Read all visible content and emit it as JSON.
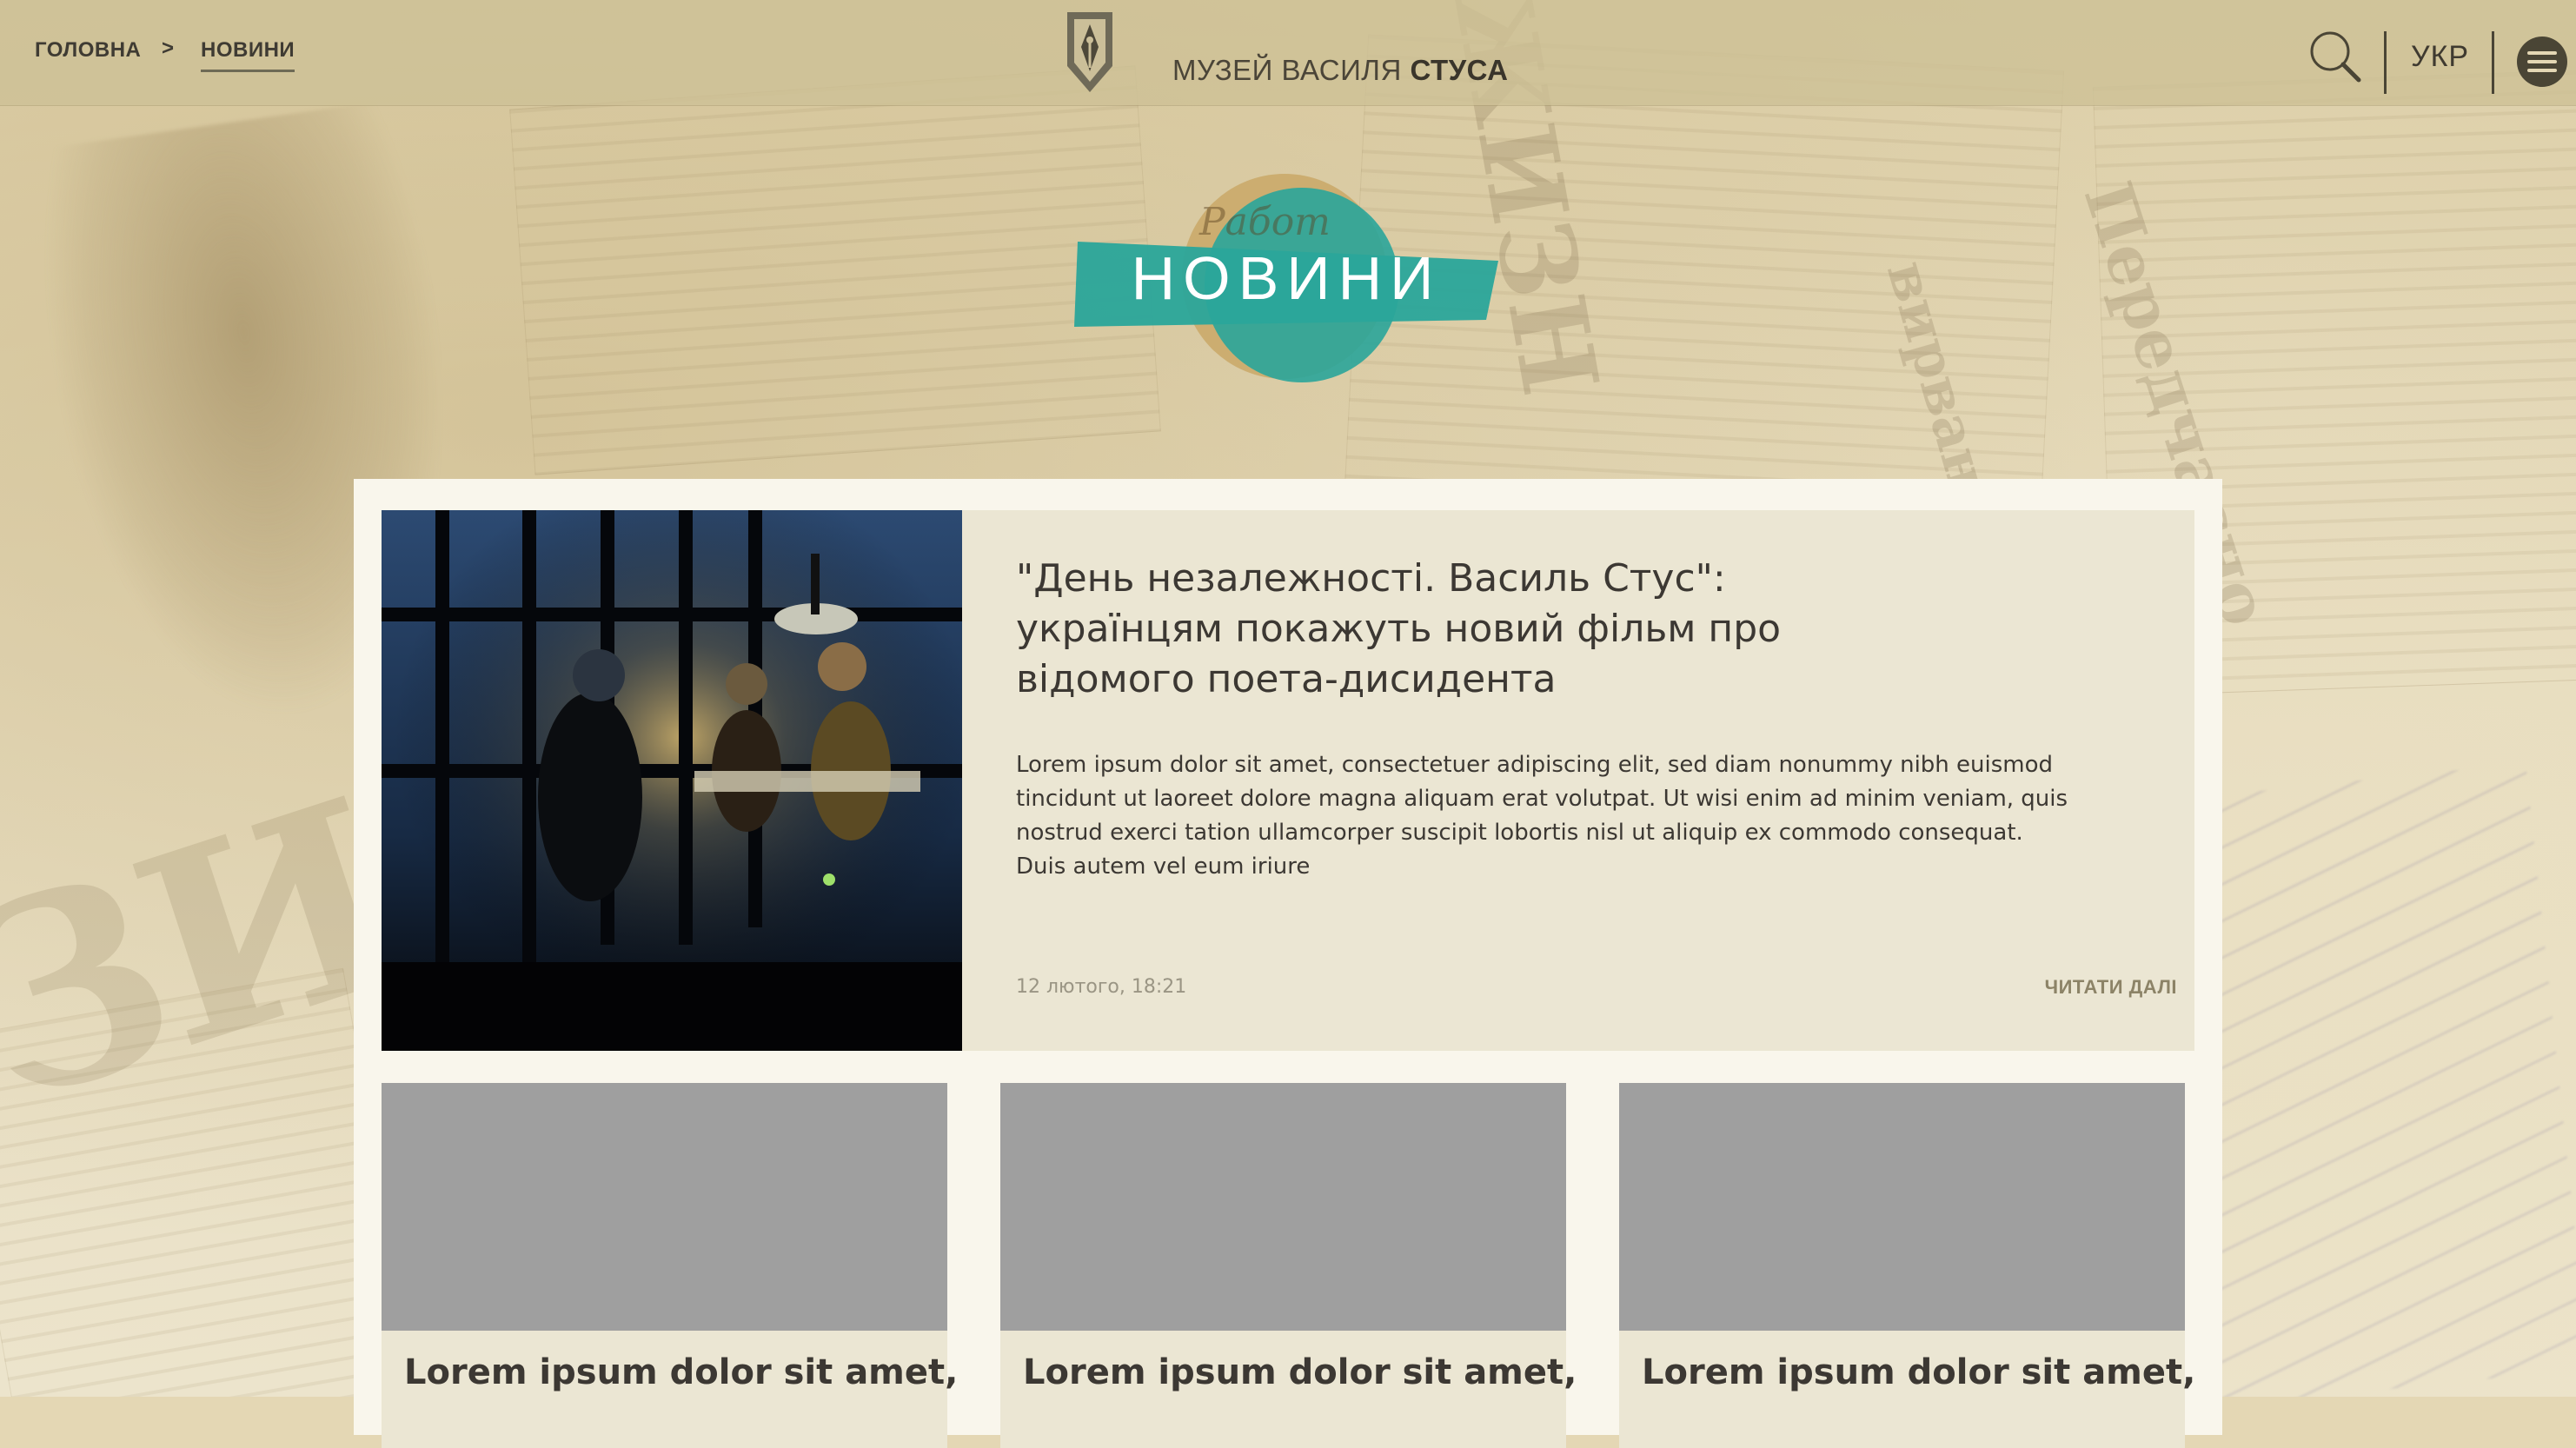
{
  "breadcrumb": {
    "home_label": "ГОЛОВНА",
    "separator": ">",
    "current_label": "НОВИНИ"
  },
  "site": {
    "title_regular": "МУЗЕЙ ВАСИЛЯ ",
    "title_bold": "СТУСА"
  },
  "header": {
    "language_label": "УКР",
    "search_icon": "search-icon",
    "menu_icon": "menu-icon"
  },
  "page": {
    "title": "НОВИНИ",
    "accent_color": "#2aa59a"
  },
  "featured": {
    "title_line1": "\"День незалежності. Василь Стус\":",
    "title_line2": "українцям покажуть новий фільм про",
    "title_line3": "відомого поета-дисидента",
    "excerpt_line1": "Lorem ipsum dolor sit amet, consectetuer adipiscing elit, sed diam nonummy nibh euismod",
    "excerpt_line2": "tincidunt ut laoreet dolore magna aliquam erat volutpat. Ut wisi enim ad minim veniam, quis",
    "excerpt_line3": "nostrud exerci tation ullamcorper suscipit lobortis nisl ut aliquip ex commodo consequat.",
    "excerpt_line4": "Duis autem vel eum iriure",
    "date": "12 лютого, 18:21",
    "read_more": "ЧИТАТИ ДАЛІ"
  },
  "cards": [
    {
      "title": "Lorem ipsum dolor sit amet,"
    },
    {
      "title": "Lorem ipsum dolor sit amet,"
    },
    {
      "title": "Lorem ipsum dolor sit amet,"
    }
  ]
}
